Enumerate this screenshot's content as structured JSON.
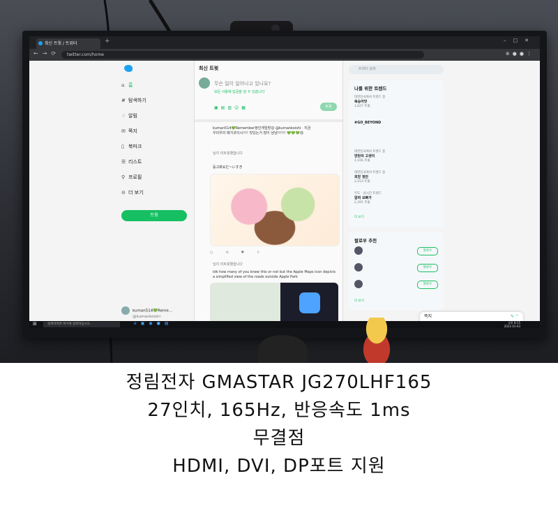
{
  "browser": {
    "tab_title": "최신 트윗 / 트위터",
    "url": "twitter.com/home"
  },
  "nav": {
    "items": [
      "홈",
      "탐색하기",
      "알림",
      "쪽지",
      "북마크",
      "리스트",
      "프로필",
      "더 보기"
    ],
    "tweet_button": "트윗",
    "account_name": "kuman514💚Reme...",
    "account_handle": "@kumankoishi"
  },
  "feed": {
    "title": "최신 트윗",
    "compose_placeholder": "무슨 일이 일어나고 있나요?",
    "compose_reply_setting": "모든 사람에 답글을 달 수 있습니다",
    "compose_button": "트윗",
    "post1_author": "kuman514💚Remember정인게임방😊 @kumankoishi · 지금",
    "post1_text": "우리우리 메가코이시!!!! 맛있는거 많이 냠냠!!!!!! 💚💚💚😍",
    "retweet_note": "님이 리트윗했습니다",
    "post2_text": "등고봐요だ~いすき",
    "post3_text": "idk how many of you knew this or not but the Apple Maps icon depicts a simplified view of the roads outside Apple Park"
  },
  "right": {
    "search_placeholder": "트위터 검색",
    "trends_title": "나를 위한 트렌드",
    "trends": [
      {
        "context": "대한민국에서 트렌드 중",
        "name": "복숭아맛",
        "count": "1,627 트윗"
      },
      {
        "context": "",
        "name": "#GO_BEYOND",
        "count": ""
      },
      {
        "context": "대한민국에서 트렌드 중",
        "name": "방탄의 고생이",
        "count": "1,106 트윗"
      },
      {
        "context": "대한민국에서 트렌드 중",
        "name": "희망 정안",
        "count": "2,253 트윗"
      },
      {
        "context": "무도 · 실시간 트렌드",
        "name": "알려 오빠가",
        "count": "2,391 트윗"
      }
    ],
    "trends_more": "더 보기",
    "follow_title": "팔로우 추천",
    "follow_button": "팔로우",
    "follow_more": "더 보기",
    "messages": "쪽지"
  },
  "taskbar": {
    "search": "검색하려면 여기에 입력하십시오.",
    "time": "오후 8:15",
    "date": "2021-01-03"
  },
  "captions": [
    "정림전자 GMASTAR JG270LHF165",
    "27인치, 165Hz, 반응속도 1ms",
    "무결점",
    "HDMI, DVI, DP포트 지원"
  ]
}
